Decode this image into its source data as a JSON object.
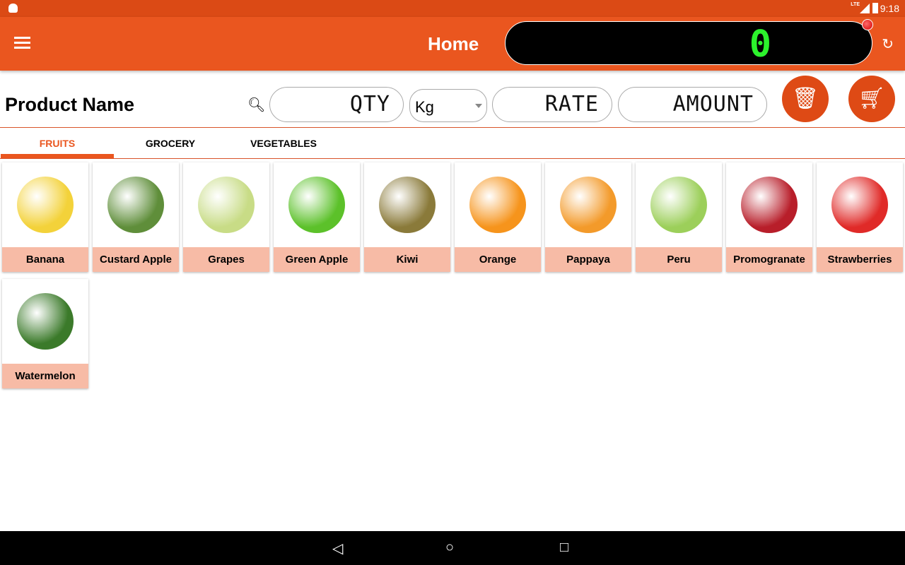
{
  "status_bar": {
    "time": "9:18",
    "network": "LTE"
  },
  "app_bar": {
    "title": "Home",
    "display_value": "0"
  },
  "toolbar": {
    "product_name": "Product Name",
    "qty_placeholder": "QTY",
    "unit": "Kg",
    "rate_placeholder": "RATE",
    "amount_placeholder": "AMOUNT"
  },
  "tabs": [
    {
      "label": "FRUITS",
      "active": true
    },
    {
      "label": "GROCERY"
    },
    {
      "label": "VEGETABLES"
    }
  ],
  "products": [
    {
      "name": "Banana",
      "color": "#f3d23a"
    },
    {
      "name": "Custard Apple",
      "color": "#5f8e3a"
    },
    {
      "name": "Grapes",
      "color": "#c8dc86"
    },
    {
      "name": "Green Apple",
      "color": "#5cc12a"
    },
    {
      "name": "Kiwi",
      "color": "#8a7a3a"
    },
    {
      "name": "Orange",
      "color": "#f6941c"
    },
    {
      "name": "Pappaya",
      "color": "#f39a2a"
    },
    {
      "name": "Peru",
      "color": "#9ccf5a"
    },
    {
      "name": "Promogranate",
      "color": "#b81e2a"
    },
    {
      "name": "Strawberries",
      "color": "#e02a28"
    },
    {
      "name": "Watermelon",
      "color": "#3b7a2a"
    }
  ],
  "colors": {
    "primary": "#ea561f",
    "status": "#db4a15",
    "label_bg": "#f7bba6",
    "display_digit": "#2cf22c"
  }
}
